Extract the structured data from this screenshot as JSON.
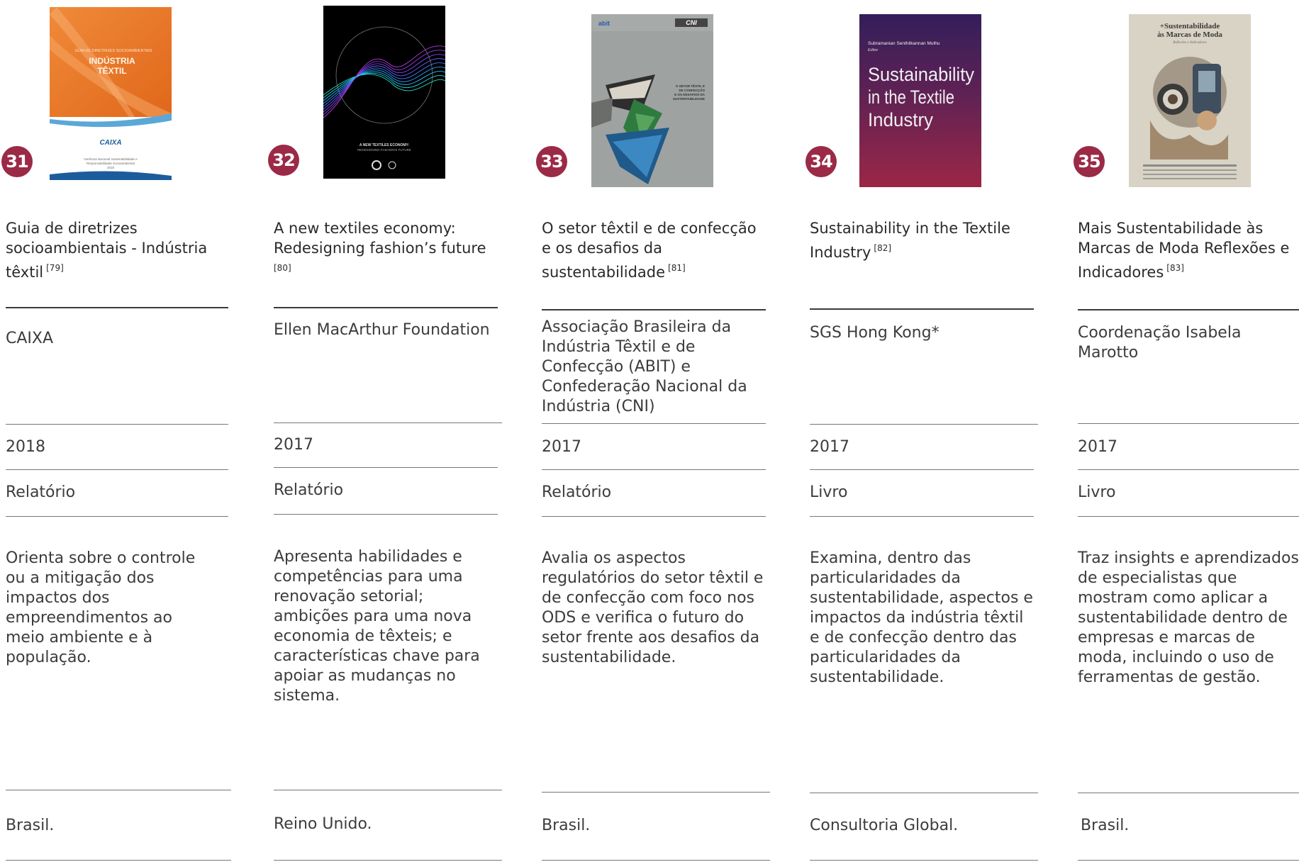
{
  "items": [
    {
      "number": "31",
      "title": "Guia de diretrizes socioambientais - Indústria têxtil",
      "ref": "[79]",
      "author": "CAIXA",
      "year": "2018",
      "type": "Relatório",
      "description": "Orienta sobre o controle ou a mitigação dos impactos dos empreendimentos ao meio ambiente e à população.",
      "country": "Brasil.",
      "cover": {
        "line1": "GUIA DE DIRETRIZES SOCIOAMBIENTAIS",
        "line2": "INDÚSTRIA",
        "line3": "TÊXTIL",
        "brand": "CAIXA",
        "footer1": "Gerência Nacional Sustentabilidade e",
        "footer2": "Responsabilidade Socioambiental",
        "footer3": "2018"
      }
    },
    {
      "number": "32",
      "title": "A new textiles economy: Redesigning fashion’s future",
      "ref": "[80]",
      "author": "Ellen MacArthur Foundation",
      "year": "2017",
      "type": "Relatório",
      "description": "Apresenta habilidades e competências para uma renovação setorial; ambições para uma nova economia de têxteis; e características chave para apoiar as mudanças no sistema.",
      "country": "Reino Unido.",
      "cover": {
        "line1": "A NEW TEXTILES ECONOMY:",
        "line2": "REDESIGNING FASHION'S FUTURE"
      }
    },
    {
      "number": "33",
      "title": "O setor têxtil e de confecção e os desafios da sustentabilidade",
      "ref": "[81]",
      "author": "Associação Brasileira da Indústria Têxtil e de Confecção (ABIT) e Confederação Nacional da Indústria (CNI)",
      "year": "2017",
      "type": "Relatório",
      "description": "Avalia os aspectos regulatórios do setor têxtil e de confecção com foco nos ODS e verifica o futuro do setor frente aos desafios da sustentabilidade.",
      "country": "Brasil.",
      "cover": {
        "logo1": "abit",
        "logo2": "CNI",
        "line1": "O SETOR TÊXTIL E",
        "line2": "DE CONFECÇÃO",
        "line3": "E OS DESAFIOS DA",
        "line4": "SUSTENTABILIDADE"
      }
    },
    {
      "number": "34",
      "title": "Sustainability in the Textile Industry",
      "ref": "[82]",
      "author": "SGS Hong Kong*",
      "year": "2017",
      "type": "Livro",
      "description": "Examina, dentro das particularidades da sustentabilidade, aspectos e impactos da indústria têxtil e de confecção dentro das particularidades da sustentabilidade.",
      "country": "Consultoria Global.",
      "cover": {
        "editor_name": "Subramanian Senthilkannan Muthu",
        "editor_role": "Editor",
        "line1": "Sustainability",
        "line2": "in the Textile",
        "line3": "Industry"
      }
    },
    {
      "number": "35",
      "title": "Mais Sustentabilidade às Marcas de Moda Reflexões e Indicadores",
      "ref": "[83]",
      "author": "Coordenação Isabela Marotto",
      "year": "2017",
      "type": "Livro",
      "description": "Traz insights e aprendizados de especialistas que mostram como aplicar a sustentabilidade dentro de empresas e marcas de moda, incluindo o uso de ferramentas de gestão.",
      "country": "Brasil.",
      "cover": {
        "line1": "+Sustentabilidade",
        "line2": "às Marcas de Moda",
        "line3": "Reflexões e Indicadores"
      }
    }
  ]
}
